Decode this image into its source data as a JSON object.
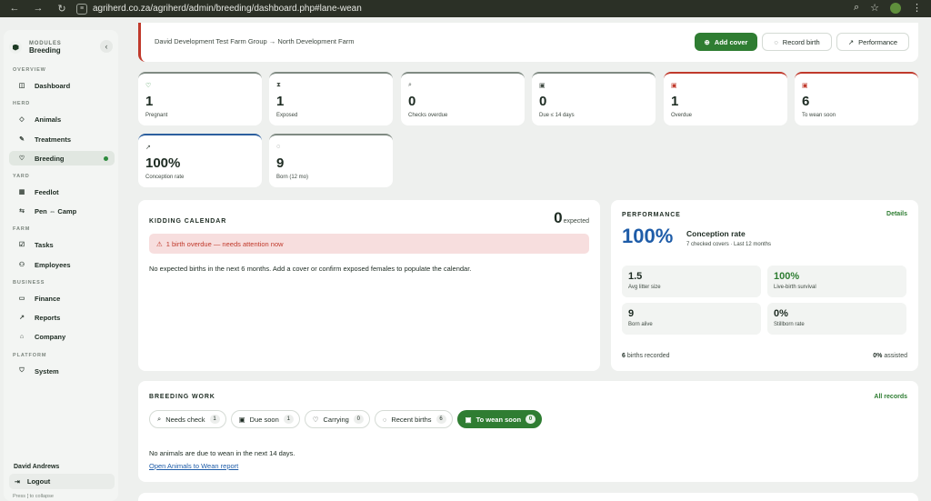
{
  "browser": {
    "url": "agriherd.co.za/agriherd/admin/breeding/dashboard.php#lane-wean"
  },
  "sidebar": {
    "module_kicker": "MODULES",
    "module_name": "Breeding",
    "sections": {
      "overview": "OVERVIEW",
      "herd": "HERD",
      "yard": "YARD",
      "farm": "FARM",
      "business": "BUSINESS",
      "platform": "PLATFORM"
    },
    "items": {
      "dashboard": "Dashboard",
      "animals": "Animals",
      "treatments": "Treatments",
      "breeding": "Breeding",
      "feedlot": "Feedlot",
      "pen_camp": "Pen ⇔ Camp",
      "tasks": "Tasks",
      "employees": "Employees",
      "finance": "Finance",
      "reports": "Reports",
      "company": "Company",
      "system": "System"
    },
    "user_name": "David Andrews",
    "logout": "Logout",
    "hint": "Press [ to collapse"
  },
  "header": {
    "breadcrumb": "David Development Test Farm Group → North Development Farm",
    "add_cover": "Add cover",
    "record_birth": "Record birth",
    "performance": "Performance"
  },
  "stats": [
    {
      "value": "1",
      "label": "Pregnant"
    },
    {
      "value": "1",
      "label": "Exposed"
    },
    {
      "value": "0",
      "label": "Checks overdue"
    },
    {
      "value": "0",
      "label": "Due ≤ 14 days"
    },
    {
      "value": "1",
      "label": "Overdue"
    },
    {
      "value": "6",
      "label": "To wean soon"
    },
    {
      "value": "100%",
      "label": "Conception rate"
    },
    {
      "value": "9",
      "label": "Born (12 mo)"
    }
  ],
  "kidding": {
    "title": "KIDDING CALENDAR",
    "count": "0",
    "count_unit": "expected",
    "alert": "1 birth overdue — needs attention now",
    "empty_text": "No expected births in the next 6 months. Add a cover or confirm exposed females to populate the calendar."
  },
  "performance": {
    "title": "PERFORMANCE",
    "details": "Details",
    "rate": "100%",
    "rate_label": "Conception rate",
    "rate_sub": "7 checked covers · Last 12 months",
    "metrics": [
      {
        "value": "1.5",
        "label": "Avg litter size"
      },
      {
        "value": "100%",
        "label": "Live-birth survival"
      },
      {
        "value": "9",
        "label": "Born alive"
      },
      {
        "value": "0%",
        "label": "Stillborn rate"
      }
    ],
    "births_count": "6",
    "births_text": "births recorded",
    "assisted_pct": "0%",
    "assisted_text": "assisted"
  },
  "breeding_work": {
    "title": "BREEDING WORK",
    "all_records": "All records",
    "tabs": [
      {
        "label": "Needs check",
        "count": "1"
      },
      {
        "label": "Due soon",
        "count": "1"
      },
      {
        "label": "Carrying",
        "count": "0"
      },
      {
        "label": "Recent births",
        "count": "6"
      },
      {
        "label": "To wean soon",
        "count": "0"
      }
    ],
    "empty_text": "No animals are due to wean in the next 14 days.",
    "report_link": "Open Animals to Wean report"
  }
}
